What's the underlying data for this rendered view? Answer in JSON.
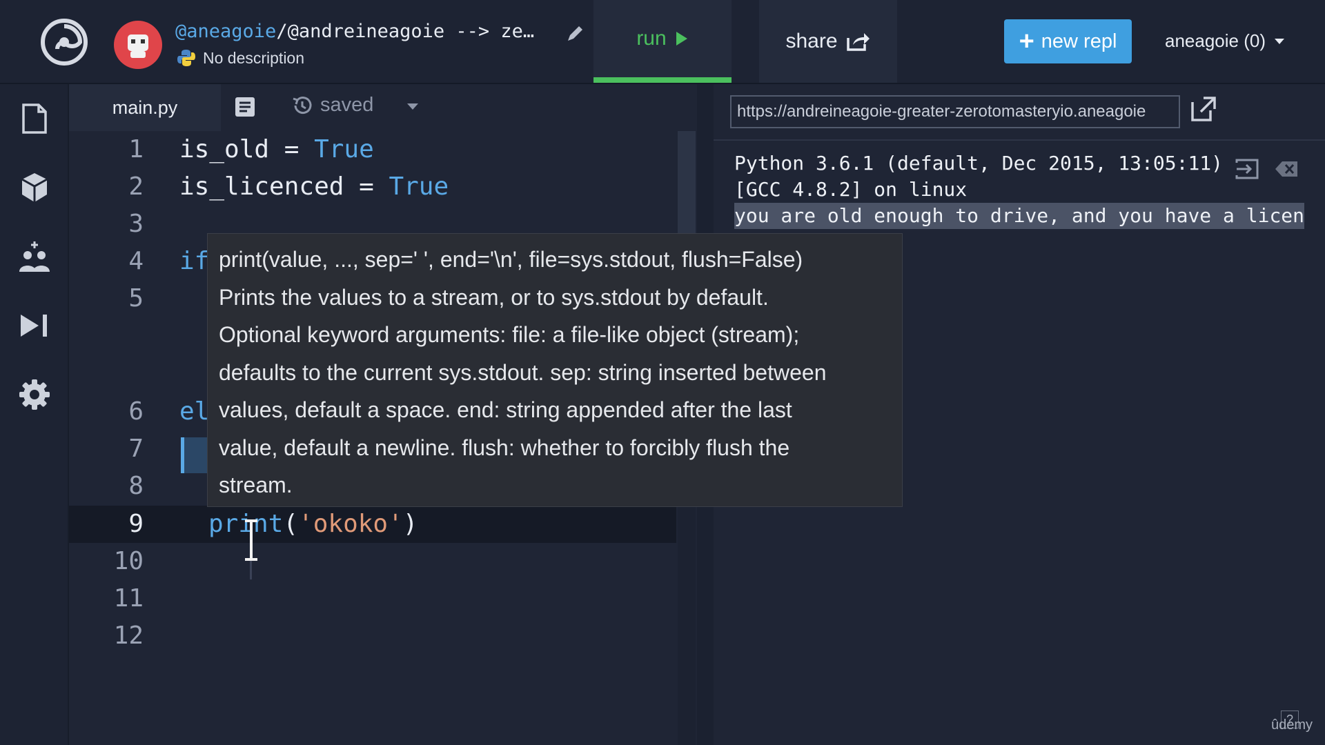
{
  "header": {
    "repl_owner": "@aneagoie",
    "repl_path": "/@andreineagoie --> ze…",
    "description": "No description",
    "run_label": "run",
    "share_label": "share",
    "new_repl_label": "new repl",
    "user_menu": "aneagoie (0)"
  },
  "editor": {
    "tab_label": "main.py",
    "saved_label": "saved",
    "lines": [
      {
        "n": "1"
      },
      {
        "n": "2"
      },
      {
        "n": "3"
      },
      {
        "n": "4"
      },
      {
        "n": "5"
      },
      {
        "n": "6"
      },
      {
        "n": "7"
      },
      {
        "n": "8"
      },
      {
        "n": "9"
      },
      {
        "n": "10"
      },
      {
        "n": "11"
      },
      {
        "n": "12"
      }
    ],
    "code": {
      "l1_a": "is_old = ",
      "l1_b": "True",
      "l2_a": "is_licenced = ",
      "l2_b": "True",
      "l4": "if",
      "l6": "el",
      "l9_fn": "print",
      "l9_open": "(",
      "l9_str": "'okoko'",
      "l9_close": ")"
    }
  },
  "tooltip": {
    "lines": [
      "print(value, ..., sep=' ', end='\\n', file=sys.stdout, flush=False)",
      "Prints the values to a stream, or to sys.stdout by default.",
      "Optional keyword arguments: file: a file-like object (stream);",
      "defaults to the current sys.stdout. sep: string inserted between",
      "values, default a space. end: string appended after the last",
      "value, default a newline. flush: whether to forcibly flush the",
      "stream."
    ]
  },
  "console": {
    "url": "https://andreineagoie-greater-zerotomasteryio.aneagoie",
    "output": [
      "Python 3.6.1 (default, Dec 2015, 13:05:11)",
      "[GCC 4.8.2] on linux",
      "you are old enough to drive, and you have a licen"
    ]
  },
  "watermark": {
    "brand": "ûdemy",
    "help": "?"
  },
  "colors": {
    "background": "#1d2333",
    "run_green": "#4bc05e",
    "accent_blue": "#3f9fe0",
    "keyword": "#5aa9e6",
    "string": "#e09a78"
  },
  "icons": [
    "repl-logo-icon",
    "avatar-icon",
    "pencil-icon",
    "python-icon",
    "play-icon",
    "share-icon",
    "files-icon",
    "packages-icon",
    "multiplayer-icon",
    "debugger-icon",
    "settings-icon",
    "document-icon",
    "history-icon",
    "external-link-icon",
    "console-input-icon",
    "clear-console-icon"
  ]
}
